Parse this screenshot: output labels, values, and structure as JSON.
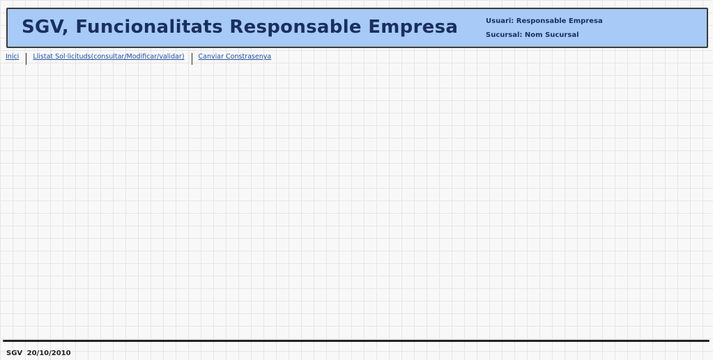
{
  "header": {
    "title": "SGV, Funcionalitats Responsable Empresa",
    "user_label": "Usuari:",
    "user_value": "Responsable Empresa",
    "branch_label": "Sucursal:",
    "branch_value": "Nom Sucursal"
  },
  "nav": {
    "items": [
      {
        "label": "Inici"
      },
      {
        "label": "Llistat Sol·licituds(consultar/Modificar/validar)"
      },
      {
        "label": "Canviar Constrasenya"
      }
    ]
  },
  "footer": {
    "text": "SGV 20/10/2010"
  },
  "colors": {
    "header_background": "#a7caf6",
    "title_text": "#1a2f5e",
    "link": "#1d4fa0",
    "grid_line": "#e6e6e6"
  }
}
